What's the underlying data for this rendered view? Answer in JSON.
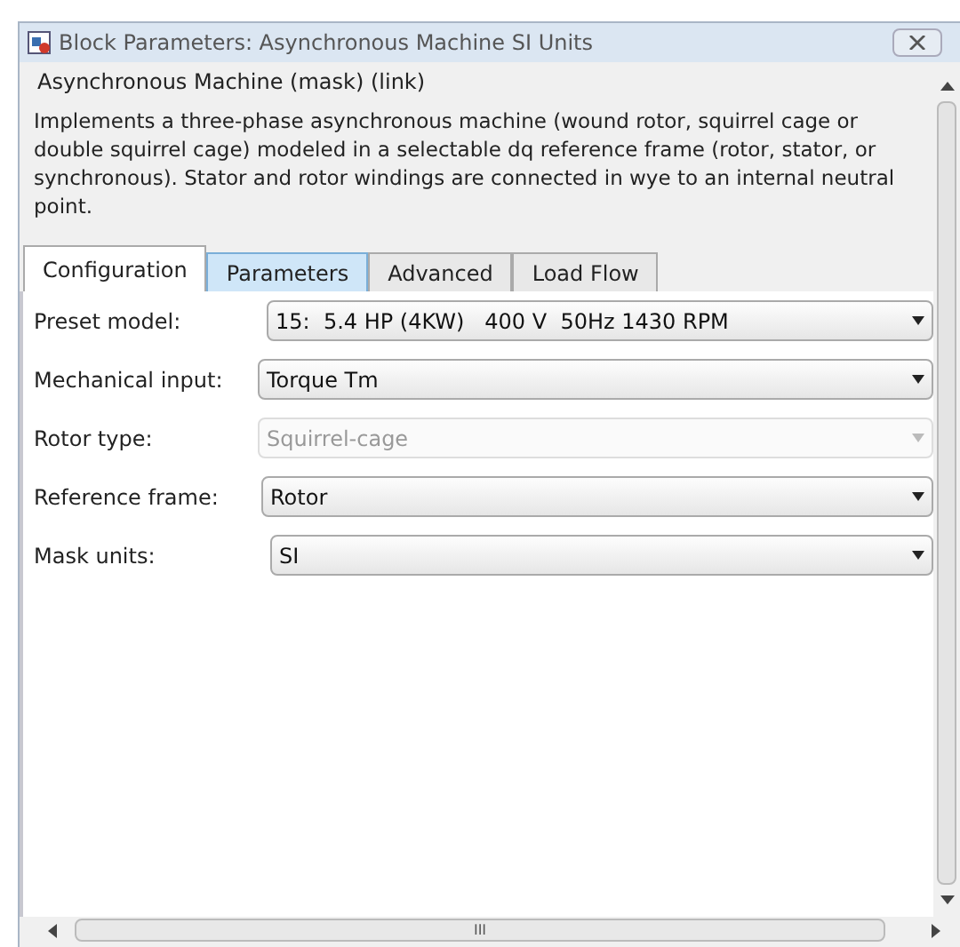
{
  "window": {
    "title": "Block Parameters: Asynchronous Machine SI Units"
  },
  "header": "Asynchronous Machine (mask) (link)",
  "description": "Implements a three-phase asynchronous machine (wound rotor, squirrel cage or double squirrel cage) modeled in a selectable dq reference frame (rotor, stator, or synchronous). Stator and rotor windings are connected in wye to an internal neutral point.",
  "tabs": [
    {
      "label": "Configuration",
      "selected": true,
      "highlighted": false
    },
    {
      "label": "Parameters",
      "selected": false,
      "highlighted": true
    },
    {
      "label": "Advanced",
      "selected": false,
      "highlighted": false
    },
    {
      "label": "Load Flow",
      "selected": false,
      "highlighted": false
    }
  ],
  "fields": [
    {
      "label": "Preset model:",
      "value": "15:  5.4 HP (4KW)   400 V  50Hz 1430 RPM",
      "disabled": false
    },
    {
      "label": "Mechanical input:",
      "value": "Torque Tm",
      "disabled": false
    },
    {
      "label": "Rotor type:",
      "value": "Squirrel-cage",
      "disabled": true
    },
    {
      "label": "Reference frame:",
      "value": "Rotor",
      "disabled": false
    },
    {
      "label": "Mask units:",
      "value": "SI",
      "disabled": false
    }
  ],
  "horizontal_scrollbar": {
    "grip": "III"
  }
}
